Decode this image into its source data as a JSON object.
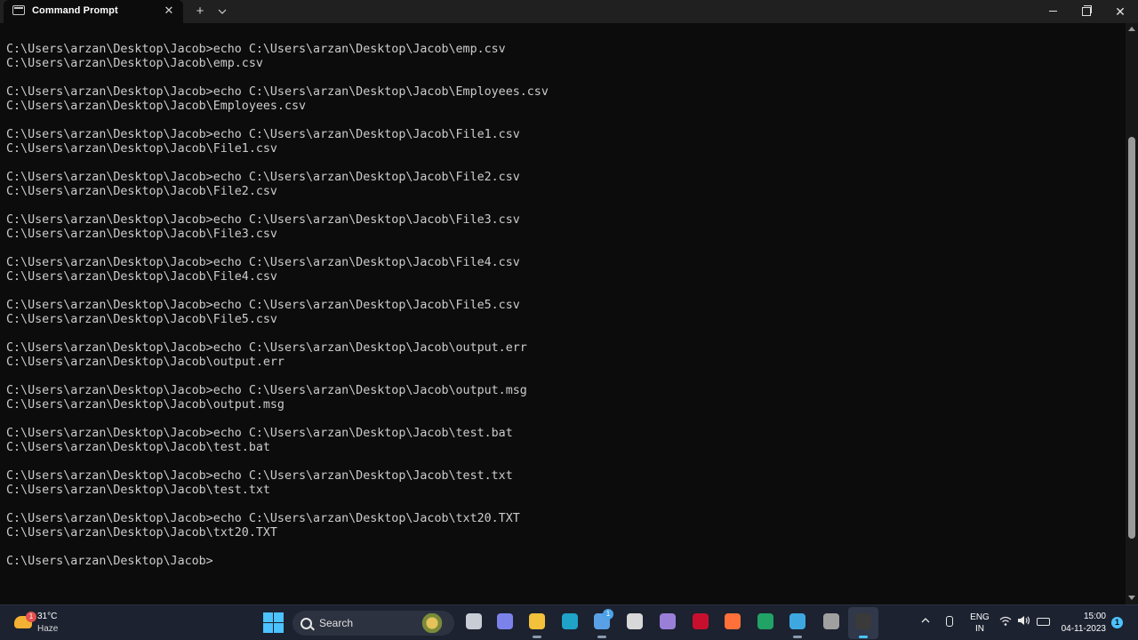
{
  "window": {
    "tab_title": "Command Prompt",
    "tab_close": "✕",
    "new_tab": "+",
    "dropdown": "⌄",
    "minimize": "",
    "maximize": "",
    "close": "✕"
  },
  "terminal": {
    "lines": [
      "C:\\Users\\arzan\\Desktop\\Jacob>echo C:\\Users\\arzan\\Desktop\\Jacob\\emp.csv",
      "C:\\Users\\arzan\\Desktop\\Jacob\\emp.csv",
      "",
      "C:\\Users\\arzan\\Desktop\\Jacob>echo C:\\Users\\arzan\\Desktop\\Jacob\\Employees.csv",
      "C:\\Users\\arzan\\Desktop\\Jacob\\Employees.csv",
      "",
      "C:\\Users\\arzan\\Desktop\\Jacob>echo C:\\Users\\arzan\\Desktop\\Jacob\\File1.csv",
      "C:\\Users\\arzan\\Desktop\\Jacob\\File1.csv",
      "",
      "C:\\Users\\arzan\\Desktop\\Jacob>echo C:\\Users\\arzan\\Desktop\\Jacob\\File2.csv",
      "C:\\Users\\arzan\\Desktop\\Jacob\\File2.csv",
      "",
      "C:\\Users\\arzan\\Desktop\\Jacob>echo C:\\Users\\arzan\\Desktop\\Jacob\\File3.csv",
      "C:\\Users\\arzan\\Desktop\\Jacob\\File3.csv",
      "",
      "C:\\Users\\arzan\\Desktop\\Jacob>echo C:\\Users\\arzan\\Desktop\\Jacob\\File4.csv",
      "C:\\Users\\arzan\\Desktop\\Jacob\\File4.csv",
      "",
      "C:\\Users\\arzan\\Desktop\\Jacob>echo C:\\Users\\arzan\\Desktop\\Jacob\\File5.csv",
      "C:\\Users\\arzan\\Desktop\\Jacob\\File5.csv",
      "",
      "C:\\Users\\arzan\\Desktop\\Jacob>echo C:\\Users\\arzan\\Desktop\\Jacob\\output.err",
      "C:\\Users\\arzan\\Desktop\\Jacob\\output.err",
      "",
      "C:\\Users\\arzan\\Desktop\\Jacob>echo C:\\Users\\arzan\\Desktop\\Jacob\\output.msg",
      "C:\\Users\\arzan\\Desktop\\Jacob\\output.msg",
      "",
      "C:\\Users\\arzan\\Desktop\\Jacob>echo C:\\Users\\arzan\\Desktop\\Jacob\\test.bat",
      "C:\\Users\\arzan\\Desktop\\Jacob\\test.bat",
      "",
      "C:\\Users\\arzan\\Desktop\\Jacob>echo C:\\Users\\arzan\\Desktop\\Jacob\\test.txt",
      "C:\\Users\\arzan\\Desktop\\Jacob\\test.txt",
      "",
      "C:\\Users\\arzan\\Desktop\\Jacob>echo C:\\Users\\arzan\\Desktop\\Jacob\\txt20.TXT",
      "C:\\Users\\arzan\\Desktop\\Jacob\\txt20.TXT",
      "",
      "C:\\Users\\arzan\\Desktop\\Jacob>"
    ]
  },
  "taskbar": {
    "weather": {
      "temp": "31°C",
      "desc": "Haze",
      "badge": "1",
      "icon": "weather-haze-icon"
    },
    "search_label": "Search",
    "apps": [
      {
        "name": "task-view-icon",
        "color": "#c8ccd4"
      },
      {
        "name": "teams-chat-icon",
        "color": "#7b83eb"
      },
      {
        "name": "file-explorer-icon",
        "color": "#f3c13a"
      },
      {
        "name": "edge-icon",
        "color": "#1fa3c9"
      },
      {
        "name": "microsoft-store-icon",
        "color": "#5aa0e6",
        "badge": "1"
      },
      {
        "name": "unity-icon",
        "color": "#d8d8d8"
      },
      {
        "name": "visual-studio-icon",
        "color": "#9a7fd8"
      },
      {
        "name": "mcafee-icon",
        "color": "#c8102e"
      },
      {
        "name": "firefox-icon",
        "color": "#ff7139"
      },
      {
        "name": "excel-icon",
        "color": "#21a366"
      },
      {
        "name": "notepad-icon",
        "color": "#3da8e0"
      },
      {
        "name": "chrome-icon",
        "color": "#a0a0a0"
      },
      {
        "name": "terminal-icon",
        "color": "#3a3a3a"
      }
    ],
    "lang_primary": "ENG",
    "lang_secondary": "IN",
    "time": "15:00",
    "date": "04-11-2023",
    "notification_count": "1"
  },
  "colors": {
    "terminal_bg": "#0c0c0c",
    "terminal_fg": "#cccccc",
    "accent": "#4cc2ff"
  }
}
